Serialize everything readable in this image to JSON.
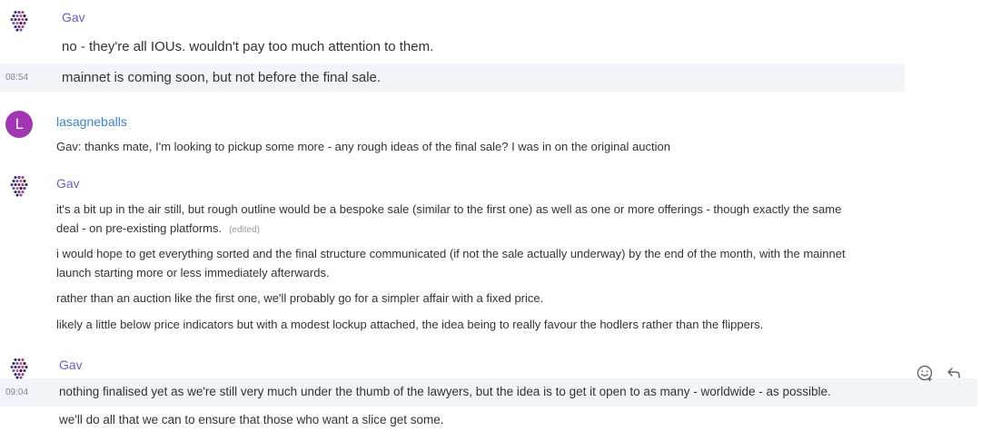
{
  "messages": [
    {
      "user": "Gav",
      "lines": [
        "no - they're all IOUs. wouldn't pay too much attention to them.",
        "mainnet is coming soon, but not before the final sale."
      ],
      "time": "08:54"
    },
    {
      "user": "lasagneballs",
      "avatar_letter": "L",
      "lines": [
        "Gav: thanks mate, I'm looking to pickup some more - any rough ideas of the final sale? I was in on the original auction"
      ]
    },
    {
      "user": "Gav",
      "lines": [
        "it's a bit up in the air still, but rough outline would be a bespoke sale (similar to the first one) as well as one or more offerings - though exactly the same",
        "deal - on pre-existing platforms.",
        "i would hope to get everything sorted and the final structure communicated (if not the sale actually underway) by the end of the month, with the mainnet",
        "launch starting more or less immediately afterwards.",
        "rather than an auction like the first one, we'll probably go for a simpler affair with a fixed price.",
        "likely a little below price indicators but with a modest lockup attached, the idea being to really favour the hodlers rather than the flippers."
      ],
      "edited": "(edited)"
    },
    {
      "user": "Gav",
      "lines": [
        "nothing finalised yet as we're still very much under the thumb of the lawyers, but the idea is to get it open to as many - worldwide - as possible.",
        "we'll do all that we can to ensure that those who want a slice get some."
      ],
      "time": "09:04"
    }
  ],
  "colors": {
    "name_purple": "#6a5ec2",
    "name_blue": "#3a83c8",
    "avatar_l": "#a235b4",
    "highlight": "#f1f5f9"
  },
  "icons": {
    "gav_avatar": "hexagon-dot-cluster-icon",
    "emoji": "smiley-icon",
    "reply": "reply-arrow-icon"
  }
}
